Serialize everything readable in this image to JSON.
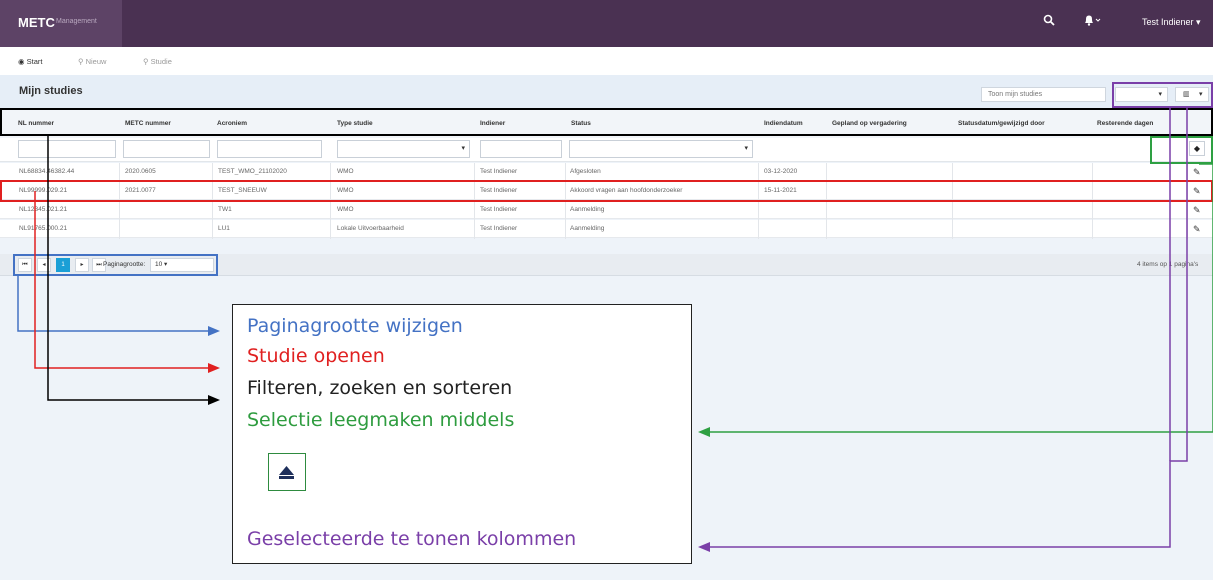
{
  "app": {
    "title": "METC",
    "subtitle": "Management",
    "user": "Test Indiener"
  },
  "nav": [
    {
      "label": "Start",
      "icon": "dashboard-icon"
    },
    {
      "label": "Nieuw",
      "icon": "search-icon"
    },
    {
      "label": "Studie",
      "icon": "search-icon"
    }
  ],
  "panel": {
    "title": "Mijn studies",
    "show_filter_value": "Toon mijn studies"
  },
  "table": {
    "columns": [
      "NL nummer",
      "METC nummer",
      "Acroniem",
      "Type studie",
      "Indiener",
      "Status",
      "Indiendatum",
      "Gepland op vergadering",
      "Statusdatum/gewijzigd door",
      "Resterende dagen"
    ],
    "rows": [
      [
        "NL68834.46382.44",
        "2020.0605",
        "TEST_WMO_21102020",
        "WMO",
        "Test Indiener",
        "Afgesloten",
        "03-12-2020"
      ],
      [
        "NL99999.029.21",
        "2021.0077",
        "TEST_SNEEUW",
        "WMO",
        "Test Indiener",
        "Akkoord vragen aan hoofdonderzoeker",
        "15-11-2021"
      ],
      [
        "NL12345.021.21",
        "",
        "TW1",
        "WMO",
        "Test Indiener",
        "Aanmelding",
        ""
      ],
      [
        "NL91765.000.21",
        "",
        "LU1",
        "Lokale Uitvoerbaarheid",
        "Test Indiener",
        "Aanmelding",
        ""
      ]
    ]
  },
  "pager": {
    "current_page": "1",
    "page_size_label": "Paginagrootte:",
    "page_size_value": "10",
    "info": "4 items op 1 pagina's"
  },
  "colors": {
    "topbar": "#4a3152",
    "blue": "#4472c4",
    "red": "#e02020",
    "black": "#000000",
    "green": "#2ea043",
    "purple": "#7a3fa8"
  },
  "legend": {
    "page_size": "Paginagrootte wijzigen",
    "open_study": "Studie openen",
    "filter": "Filteren, zoeken en sorteren",
    "clear": "Selectie leegmaken middels",
    "columns": "Geselecteerde te tonen kolommen"
  }
}
